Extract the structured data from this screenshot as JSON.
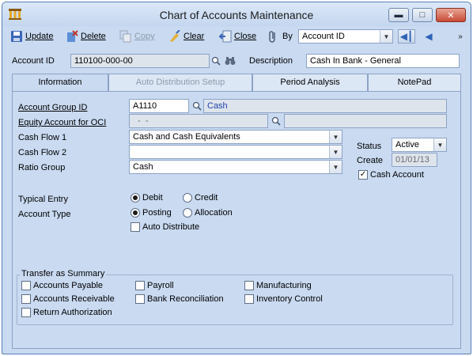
{
  "window": {
    "title": "Chart of Accounts Maintenance"
  },
  "toolbar": {
    "update": "Update",
    "delete": "Delete",
    "copy": "Copy",
    "clear": "Clear",
    "close": "Close",
    "by_label": "By",
    "by_value": "Account ID"
  },
  "header": {
    "account_id_label": "Account ID",
    "account_id_value": "110100-000-00",
    "description_label": "Description",
    "description_value": "Cash In Bank - General"
  },
  "tabs": [
    {
      "label": "Information"
    },
    {
      "label": "Auto Distribution Setup"
    },
    {
      "label": "Period Analysis"
    },
    {
      "label": "NotePad"
    }
  ],
  "info": {
    "account_group_label": "Account Group ID",
    "account_group_value": "A1110",
    "account_group_desc": "Cash",
    "equity_label": "Equity Account for OCI",
    "equity_value": "  -  -",
    "cash_flow1_label": "Cash Flow 1",
    "cash_flow1_value": "Cash and Cash Equivalents",
    "cash_flow2_label": "Cash Flow 2",
    "cash_flow2_value": "",
    "ratio_group_label": "Ratio Group",
    "ratio_group_value": "Cash",
    "status_label": "Status",
    "status_value": "Active",
    "create_label": "Create",
    "create_value": "01/01/13",
    "cash_account_label": "Cash Account",
    "typical_entry_label": "Typical Entry",
    "debit_label": "Debit",
    "credit_label": "Credit",
    "account_type_label": "Account Type",
    "posting_label": "Posting",
    "allocation_label": "Allocation",
    "auto_distribute_label": "Auto Distribute"
  },
  "summary": {
    "title": "Transfer as Summary",
    "accounts_payable": "Accounts Payable",
    "accounts_receivable": "Accounts Receivable",
    "return_authorization": "Return Authorization",
    "payroll": "Payroll",
    "bank_reconciliation": "Bank Reconciliation",
    "manufacturing": "Manufacturing",
    "inventory_control": "Inventory Control"
  }
}
